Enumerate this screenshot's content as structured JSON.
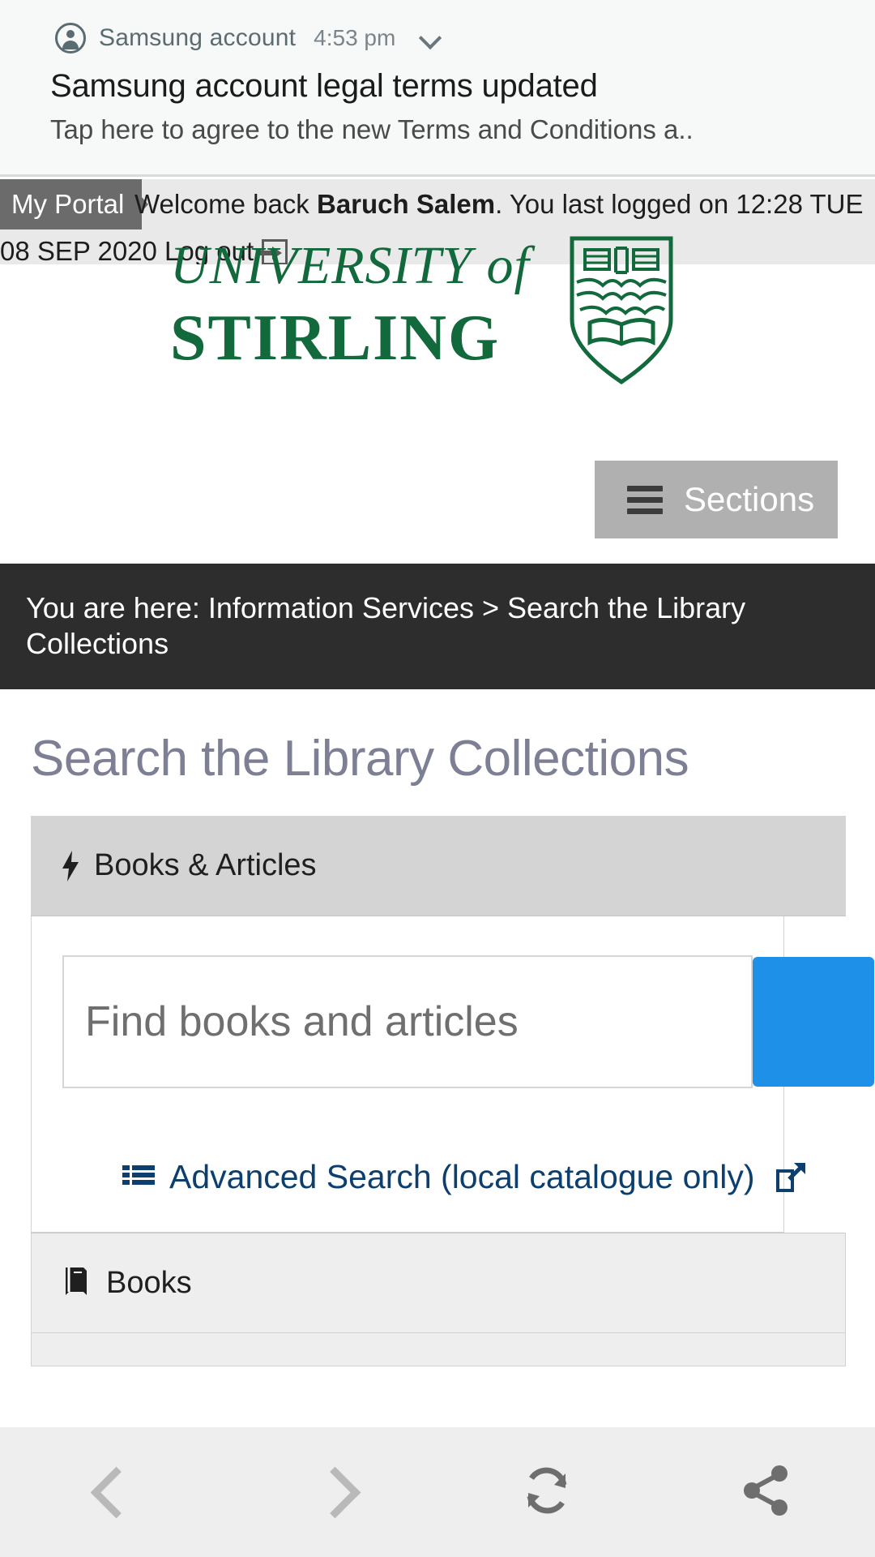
{
  "notification": {
    "app_icon": "account-avatar-icon",
    "app_name": "Samsung account",
    "time": "4:53 pm",
    "expand_icon": "chevron-down-icon",
    "title": "Samsung account legal terms updated",
    "body": "Tap here to agree to the new Terms and Conditions a.."
  },
  "portal_bar": {
    "tag": "My Portal",
    "welcome_prefix": "Welcome back ",
    "user_name": "Baruch Salem",
    "welcome_suffix": ". You last logged on 12:28 TUE",
    "second_line": "08 SEP 2020 Log out",
    "logout_icon": "logout-arrow-icon"
  },
  "branding": {
    "university_line": "UNIVERSITY of",
    "stirling_line": "STIRLING",
    "crest_icon": "university-crest-icon",
    "brand_green": "#12693c"
  },
  "nav": {
    "sections_label": "Sections",
    "sections_icon": "hamburger-menu-icon",
    "sections_bg": "#b0b0b0"
  },
  "breadcrumb": {
    "text": "You are here: Information Services > Search the Library Collections",
    "bg": "#2d2d2d"
  },
  "main": {
    "page_title": "Search the Library Collections",
    "panels": [
      {
        "header_label": "Books & Articles",
        "header_icon": "lightning-bolt-icon",
        "search_placeholder": "Find books and articles",
        "search_value": "",
        "search_button_icon": "search-submit-button",
        "search_button_color": "#1e90e8",
        "advanced_link": "Advanced Search (local catalogue only)",
        "advanced_link_icon": "list-icon",
        "advanced_link_external_icon": "external-link-icon",
        "advanced_link_color": "#0d3f6e"
      },
      {
        "header_label": "Books",
        "header_icon": "book-icon"
      }
    ]
  },
  "bottom_bar": {
    "items": [
      {
        "name": "back-button",
        "icon": "chevron-left-icon"
      },
      {
        "name": "forward-button",
        "icon": "chevron-right-icon"
      },
      {
        "name": "reload-button",
        "icon": "refresh-icon"
      },
      {
        "name": "share-button",
        "icon": "share-icon"
      }
    ]
  }
}
